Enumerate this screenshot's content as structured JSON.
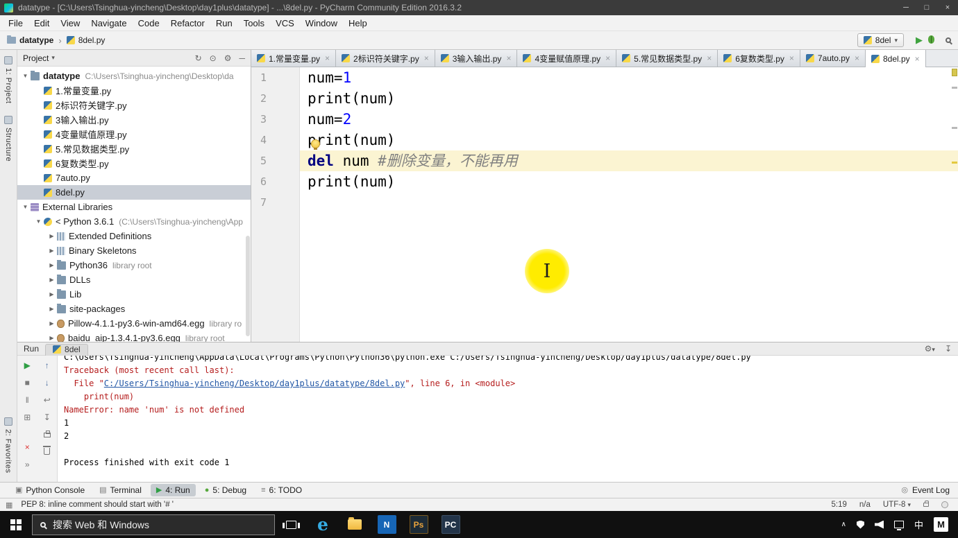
{
  "window": {
    "title": "datatype - [C:\\Users\\Tsinghua-yincheng\\Desktop\\day1plus\\datatype] - ...\\8del.py - PyCharm Community Edition 2016.3.2"
  },
  "menu_bar": {
    "items": [
      "File",
      "Edit",
      "View",
      "Navigate",
      "Code",
      "Refactor",
      "Run",
      "Tools",
      "VCS",
      "Window",
      "Help"
    ]
  },
  "toolbar": {
    "breadcrumb_project": "datatype",
    "breadcrumb_file": "8del.py",
    "run_config": "8del"
  },
  "left_strip": {
    "project": "1: Project",
    "structure": "Structure",
    "favorites": "2: Favorites"
  },
  "project_panel": {
    "header": "Project",
    "tree": [
      {
        "indent": 0,
        "arrow": "down",
        "icon": "folder",
        "label": "datatype",
        "suffix": "C:\\Users\\Tsinghua-yincheng\\Desktop\\da",
        "bold": true
      },
      {
        "indent": 1,
        "arrow": "",
        "icon": "py",
        "label": "1.常量变量.py"
      },
      {
        "indent": 1,
        "arrow": "",
        "icon": "py",
        "label": "2标识符关键字.py"
      },
      {
        "indent": 1,
        "arrow": "",
        "icon": "py",
        "label": "3输入输出.py"
      },
      {
        "indent": 1,
        "arrow": "",
        "icon": "py",
        "label": "4变量赋值原理.py"
      },
      {
        "indent": 1,
        "arrow": "",
        "icon": "py",
        "label": "5.常见数据类型.py"
      },
      {
        "indent": 1,
        "arrow": "",
        "icon": "py",
        "label": "6复数类型.py"
      },
      {
        "indent": 1,
        "arrow": "",
        "icon": "py",
        "label": "7auto.py"
      },
      {
        "indent": 1,
        "arrow": "",
        "icon": "py",
        "label": "8del.py",
        "selected": true
      },
      {
        "indent": 0,
        "arrow": "down",
        "icon": "lib",
        "label": "External Libraries"
      },
      {
        "indent": 1,
        "arrow": "down",
        "icon": "python",
        "label": "< Python 3.6.1",
        "suffix": "(C:\\Users\\Tsinghua-yincheng\\App"
      },
      {
        "indent": 2,
        "arrow": "right",
        "icon": "defs",
        "label": "Extended Definitions"
      },
      {
        "indent": 2,
        "arrow": "right",
        "icon": "defs",
        "label": "Binary Skeletons"
      },
      {
        "indent": 2,
        "arrow": "right",
        "icon": "folder",
        "label": "Python36",
        "suffix": "library root"
      },
      {
        "indent": 2,
        "arrow": "right",
        "icon": "folder",
        "label": "DLLs"
      },
      {
        "indent": 2,
        "arrow": "right",
        "icon": "folder",
        "label": "Lib"
      },
      {
        "indent": 2,
        "arrow": "right",
        "icon": "folder",
        "label": "site-packages"
      },
      {
        "indent": 2,
        "arrow": "right",
        "icon": "egg",
        "label": "Pillow-4.1.1-py3.6-win-amd64.egg",
        "suffix": "library ro"
      },
      {
        "indent": 2,
        "arrow": "right",
        "icon": "egg",
        "label": "baidu_aip-1.3.4.1-py3.6.egg",
        "suffix": "library root"
      }
    ]
  },
  "editor": {
    "tabs": [
      {
        "label": "1.常量变量.py"
      },
      {
        "label": "2标识符关键字.py"
      },
      {
        "label": "3输入输出.py"
      },
      {
        "label": "4变量赋值原理.py"
      },
      {
        "label": "5.常见数据类型.py"
      },
      {
        "label": "6复数类型.py"
      },
      {
        "label": "7auto.py"
      },
      {
        "label": "8del.py",
        "active": true
      }
    ],
    "code_lines": [
      {
        "num": "1",
        "spans": [
          {
            "t": "num=",
            "c": "plain"
          },
          {
            "t": "1",
            "c": "number"
          }
        ]
      },
      {
        "num": "2",
        "spans": [
          {
            "t": "print(num)",
            "c": "plain"
          }
        ]
      },
      {
        "num": "3",
        "spans": [
          {
            "t": "num=",
            "c": "plain"
          },
          {
            "t": "2",
            "c": "number"
          }
        ]
      },
      {
        "num": "4",
        "spans": [
          {
            "t": "print(num)",
            "c": "plain"
          }
        ]
      },
      {
        "num": "5",
        "highlight": true,
        "spans": [
          {
            "t": "del",
            "c": "keyword"
          },
          {
            "t": " num ",
            "c": "plain"
          },
          {
            "t": "#删除变量，不能再用",
            "c": "comment"
          }
        ]
      },
      {
        "num": "6",
        "spans": [
          {
            "t": "print(num)",
            "c": "plain"
          }
        ]
      },
      {
        "num": "7",
        "spans": []
      }
    ]
  },
  "run_panel": {
    "title": "Run",
    "tab": "8del",
    "console_lines": [
      {
        "spans": [
          {
            "t": "C:\\Users\\Tsinghua-yincheng\\AppData\\Local\\Programs\\Python\\Python36\\python.exe C:/Users/Tsinghua-yincheng/Desktop/day1plus/datatype/8del.py",
            "c": "out"
          }
        ]
      },
      {
        "spans": [
          {
            "t": "Traceback (most recent call last):",
            "c": "err"
          }
        ]
      },
      {
        "spans": [
          {
            "t": "  File \"",
            "c": "err"
          },
          {
            "t": "C:/Users/Tsinghua-yincheng/Desktop/day1plus/datatype/8del.py",
            "c": "link"
          },
          {
            "t": "\", line 6, in <module>",
            "c": "err"
          }
        ]
      },
      {
        "spans": [
          {
            "t": "    print(num)",
            "c": "err"
          }
        ]
      },
      {
        "spans": [
          {
            "t": "NameError: name 'num' is not defined",
            "c": "err"
          }
        ]
      },
      {
        "spans": [
          {
            "t": "1",
            "c": "out"
          }
        ]
      },
      {
        "spans": [
          {
            "t": "2",
            "c": "out"
          }
        ]
      },
      {
        "spans": [
          {
            "t": " ",
            "c": "out"
          }
        ]
      },
      {
        "spans": [
          {
            "t": "Process finished with exit code 1",
            "c": "out"
          }
        ]
      }
    ]
  },
  "bottom_bar": {
    "left_items": [
      {
        "label": "Python Console",
        "icon": "console"
      },
      {
        "label": "Terminal",
        "icon": "terminal"
      },
      {
        "label": "4: Run",
        "icon": "run",
        "active": true
      },
      {
        "label": "5: Debug",
        "icon": "debug"
      },
      {
        "label": "6: TODO",
        "icon": "todo"
      }
    ],
    "event_log": "Event Log"
  },
  "status_bar": {
    "message": "PEP 8: inline comment should start with '# '",
    "caret_position": "5:19",
    "line_separator": "n/a",
    "encoding": "UTF-8"
  },
  "taskbar": {
    "search_placeholder": "搜索 Web 和 Windows",
    "ime_indicator": "中",
    "ime_badge": "M"
  },
  "colors": {
    "run_green": "#3fa33f",
    "stderr_red": "#b51d1d",
    "link_blue": "#2156a5",
    "caret_line_yellow": "#fbf4d2",
    "keyword_navy": "#000080",
    "number_blue": "#0000ff",
    "comment_gray": "#808080",
    "cursor_highlight_yellow": "#ffec00"
  }
}
